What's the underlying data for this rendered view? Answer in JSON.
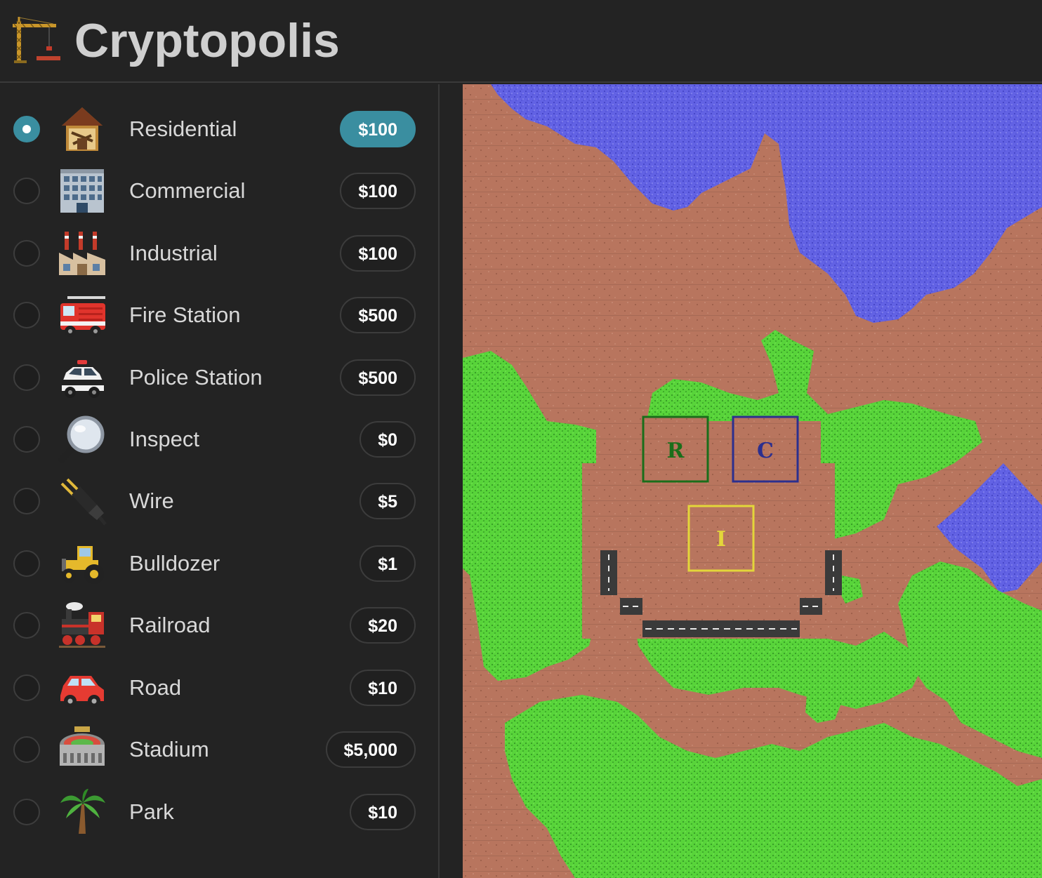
{
  "header": {
    "title": "Cryptopolis",
    "logo_icon": "construction-crane-icon"
  },
  "tools": [
    {
      "label": "Residential",
      "price": "$100",
      "icon": "house-icon",
      "selected": true
    },
    {
      "label": "Commercial",
      "price": "$100",
      "icon": "office-building-icon",
      "selected": false
    },
    {
      "label": "Industrial",
      "price": "$100",
      "icon": "factory-icon",
      "selected": false
    },
    {
      "label": "Fire Station",
      "price": "$500",
      "icon": "fire-truck-icon",
      "selected": false
    },
    {
      "label": "Police Station",
      "price": "$500",
      "icon": "police-car-icon",
      "selected": false
    },
    {
      "label": "Inspect",
      "price": "$0",
      "icon": "magnifying-glass-icon",
      "selected": false
    },
    {
      "label": "Wire",
      "price": "$5",
      "icon": "electric-plug-icon",
      "selected": false
    },
    {
      "label": "Bulldozer",
      "price": "$1",
      "icon": "tractor-icon",
      "selected": false
    },
    {
      "label": "Railroad",
      "price": "$20",
      "icon": "locomotive-icon",
      "selected": false
    },
    {
      "label": "Road",
      "price": "$10",
      "icon": "car-icon",
      "selected": false
    },
    {
      "label": "Stadium",
      "price": "$5,000",
      "icon": "stadium-icon",
      "selected": false
    },
    {
      "label": "Park",
      "price": "$10",
      "icon": "palm-tree-icon",
      "selected": false
    }
  ],
  "map": {
    "zones": [
      {
        "letter": "R",
        "color": "#1a6e1a"
      },
      {
        "letter": "C",
        "color": "#2c2f8e"
      },
      {
        "letter": "I",
        "color": "#e3d63a"
      }
    ]
  },
  "colors": {
    "accent": "#3a8ea0",
    "dirt": "#b8755e",
    "water": "#6666e6",
    "grass": "#5ad83e"
  }
}
